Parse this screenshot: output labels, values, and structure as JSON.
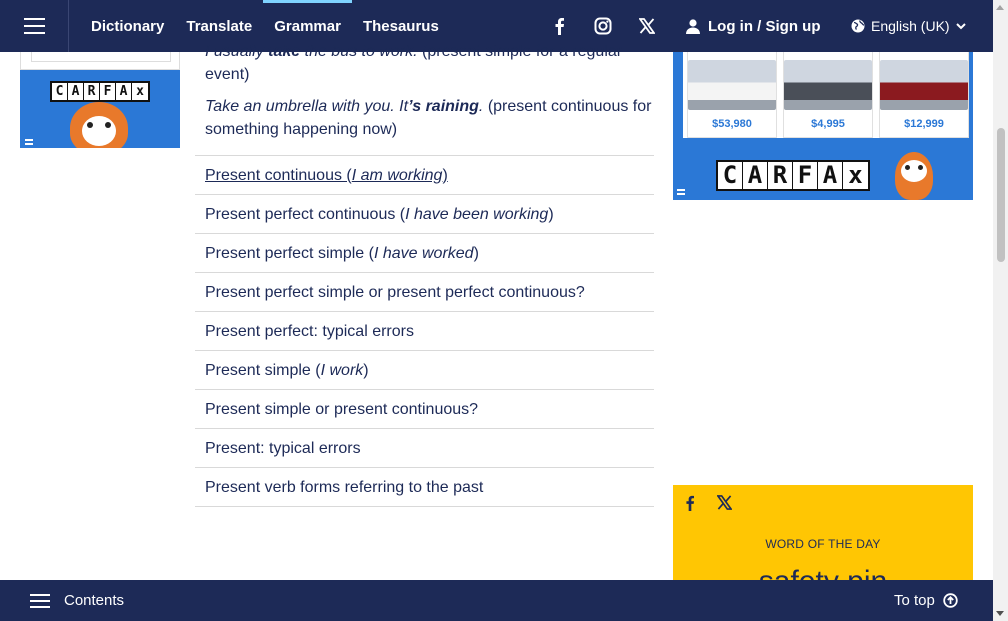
{
  "nav": {
    "links": [
      "Dictionary",
      "Translate",
      "Grammar",
      "Thesaurus"
    ],
    "active": "Grammar",
    "login": "Log in / Sign up",
    "language": "English (UK)",
    "social_icons": [
      "facebook-icon",
      "instagram-icon",
      "x-icon"
    ]
  },
  "examples": [
    {
      "parts": [
        [
          "i",
          "I usually "
        ],
        [
          "bi",
          "take"
        ],
        [
          "i",
          " the bus to work."
        ],
        [
          "t",
          " (present simple for a regular event)"
        ]
      ]
    },
    {
      "parts": [
        [
          "i",
          "Take an umbrella with you. It"
        ],
        [
          "bi",
          "’s raining"
        ],
        [
          "i",
          "."
        ],
        [
          "t",
          " (present continuous for something happening now)"
        ]
      ]
    }
  ],
  "related": [
    {
      "pre": "Present continuous (",
      "it": "I am working",
      "post": ")"
    },
    {
      "pre": "Present perfect continuous (",
      "it": "I have been working",
      "post": ")"
    },
    {
      "pre": "Present perfect simple (",
      "it": "I have worked",
      "post": ")"
    },
    {
      "pre": "Present perfect simple or present perfect continuous?",
      "it": "",
      "post": ""
    },
    {
      "pre": "Present perfect: typical errors",
      "it": "",
      "post": ""
    },
    {
      "pre": "Present simple (",
      "it": "I work",
      "post": ")"
    },
    {
      "pre": "Present simple or present continuous?",
      "it": "",
      "post": ""
    },
    {
      "pre": "Present: typical errors",
      "it": "",
      "post": ""
    },
    {
      "pre": "Present verb forms referring to the past",
      "it": "",
      "post": ""
    }
  ],
  "ads": {
    "brand_letters": [
      "C",
      "A",
      "R",
      "F",
      "A",
      "x"
    ],
    "car_prices": [
      "$53,980",
      "$4,995",
      "$12,999"
    ],
    "car_colors": [
      "#f4f4f4",
      "#4a4f58",
      "#8b1a1f"
    ]
  },
  "wotd": {
    "label": "WORD OF THE DAY",
    "word": "safety pin"
  },
  "bottom": {
    "contents": "Contents",
    "to_top": "To top"
  },
  "colors": {
    "navy": "#1d2a57",
    "accent": "#7fd3ff",
    "wotd_yellow": "#ffc603",
    "ad_blue": "#2b78d6"
  }
}
